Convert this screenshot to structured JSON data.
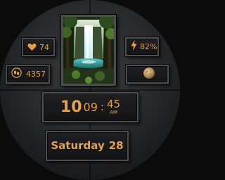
{
  "complications": {
    "heart_rate": {
      "icon": "heart-icon",
      "value": "74"
    },
    "steps": {
      "icon": "footprints-icon",
      "value": "4357"
    },
    "battery": {
      "icon": "lightning-bolt-icon",
      "value": "82%"
    },
    "moon_phase": {
      "icon": "moon-phase-icon"
    }
  },
  "photo": {
    "icon": "waterfall-forest-image"
  },
  "time": {
    "hour": "10",
    "minute": "09",
    "separator": ":",
    "second": "45",
    "ampm": "AM"
  },
  "date": {
    "weekday": "Saturday",
    "day": "28"
  },
  "colors": {
    "accent": "#e2a25a",
    "tile_border": "#4d4e51",
    "dial": "#2a2b2d",
    "background": "#0b0b0c"
  }
}
